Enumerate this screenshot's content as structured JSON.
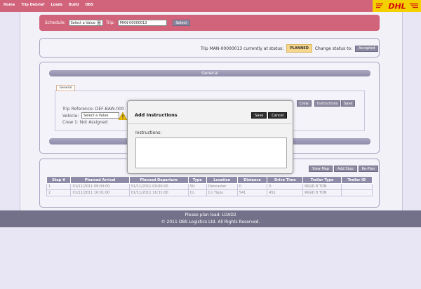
{
  "nav": {
    "items": [
      "Home",
      "Trip Debrief",
      "Loads",
      "Build",
      "OBS"
    ]
  },
  "logo": {
    "text": "DHL"
  },
  "schedule": {
    "label": "Schedule:",
    "select_value": "Select a Value",
    "trip_label": "Trip:",
    "trip_value": "MAN-00000013",
    "select_button": "Select"
  },
  "status": {
    "text": "Trip MAN-00000013 currently at status:",
    "badge": "PLANNED",
    "change_label": "Change status to:",
    "change_button": "Accepted"
  },
  "general": {
    "header": "General",
    "tab": "General",
    "trip_reference": "Trip Reference: DEF-BAW-000",
    "vehicle_label": "Vehicle:",
    "vehicle_value": "Select a Value",
    "crew_text": "Crew 1: Not Assigned",
    "buttons": {
      "crew": "Crew",
      "instructions": "Instructions",
      "save": "Save"
    }
  },
  "stops_buttons": {
    "view_map": "View Map",
    "add_stop": "Add Stop",
    "re_plan": "Re-Plan"
  },
  "table": {
    "headers": [
      "Stop #",
      "Planned Arrival",
      "Planned Departure",
      "Type",
      "Location",
      "Distance",
      "Drive Time",
      "Trailer Type",
      "Trailer ID"
    ],
    "rows": [
      [
        "1",
        "01/11/2011 09:00:00",
        "01/11/2011 09:00:00",
        "SU",
        "Doncaster",
        "0",
        "0",
        "RIGID 8 TON",
        ""
      ],
      [
        "2",
        "01/11/2011 16:01:00",
        "01/11/2011 16:31:00",
        "CL",
        "Co Tipps",
        "541",
        "451",
        "RIGID 8 TON",
        ""
      ]
    ]
  },
  "footer": {
    "message": "Please plan load: LOAD2",
    "copyright": "© 2011 OBS Logistics Ltd. All Rights Reserved."
  },
  "modal": {
    "title": "Add Instructions",
    "save": "Save",
    "cancel": "Cancel",
    "label": "Instructions:",
    "value": ""
  },
  "colors": {
    "topbar": "#d1637a",
    "accent_yellow": "#f5d000",
    "panel_border": "#a6a3c0"
  }
}
